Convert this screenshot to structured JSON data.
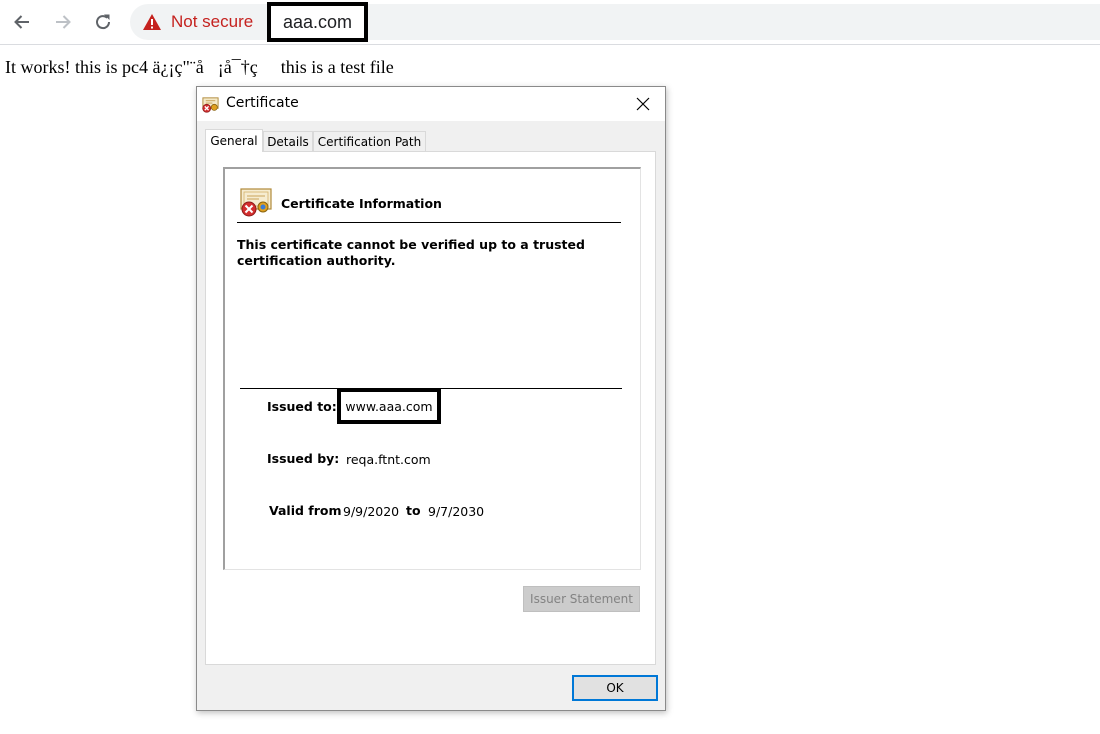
{
  "browser": {
    "nav": {
      "back_icon": "arrow-left-icon",
      "forward_icon": "arrow-right-icon",
      "reload_icon": "reload-icon"
    },
    "security": {
      "icon": "warning-triangle-icon",
      "label": "Not secure",
      "color": "#c5221f"
    },
    "url": "aaa.com"
  },
  "page": {
    "text": "It works! this is pc4 ä¿¡ç\"¨å\u0000¡å¯†ç \u0000 this is a test file"
  },
  "dialog": {
    "title": "Certificate",
    "title_icon": "certificate-error-icon",
    "close_icon": "close-icon",
    "tabs": [
      {
        "label": "General",
        "active": true
      },
      {
        "label": "Details",
        "active": false
      },
      {
        "label": "Certification Path",
        "active": false
      }
    ],
    "info": {
      "icon": "certificate-error-icon",
      "heading": "Certificate Information",
      "message": "This certificate cannot be verified up to a trusted certification authority.",
      "issued_to_label": "Issued to:",
      "issued_to": "www.aaa.com",
      "issued_by_label": "Issued by:",
      "issued_by": "reqa.ftnt.com",
      "valid_from_label": "Valid from",
      "valid_from": "9/9/2020",
      "to_label": "to",
      "valid_to": "9/7/2030"
    },
    "issuer_statement_label": "Issuer Statement",
    "ok_label": "OK",
    "accent_color": "#0078d7"
  }
}
